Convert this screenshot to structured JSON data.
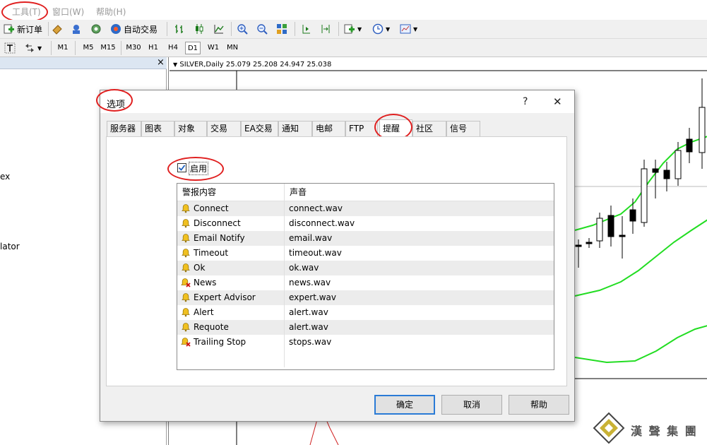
{
  "menu": {
    "tools": "工具(T)",
    "window": "窗口(W)",
    "help": "帮助(H)"
  },
  "toolbar": {
    "new_order": "新订单",
    "auto_trade": "自动交易"
  },
  "timeframes": [
    "M1",
    "M5",
    "M15",
    "M30",
    "H1",
    "H4",
    "D1",
    "W1",
    "MN"
  ],
  "active_timeframe": "D1",
  "navigator": {
    "close": "×",
    "frag1": "ex",
    "frag2": "lator"
  },
  "chart": {
    "title": "SILVER,Daily  25.079 25.208 24.947 25.038"
  },
  "dialog": {
    "title": "选项",
    "help_glyph": "?",
    "close_glyph": "✕",
    "tabs": [
      "服务器",
      "图表",
      "对象",
      "交易",
      "EA交易",
      "通知",
      "电邮",
      "FTP",
      "提醒",
      "社区",
      "信号"
    ],
    "active_tab": "提醒",
    "enable_label": "启用",
    "columns": [
      "警报内容",
      "声音"
    ],
    "rows": [
      {
        "event": "Connect",
        "sound": "connect.wav",
        "enabled": true
      },
      {
        "event": "Disconnect",
        "sound": "disconnect.wav",
        "enabled": true
      },
      {
        "event": "Email Notify",
        "sound": "email.wav",
        "enabled": true
      },
      {
        "event": "Timeout",
        "sound": "timeout.wav",
        "enabled": true
      },
      {
        "event": "Ok",
        "sound": "ok.wav",
        "enabled": true
      },
      {
        "event": "News",
        "sound": "news.wav",
        "enabled": false
      },
      {
        "event": "Expert Advisor",
        "sound": "expert.wav",
        "enabled": true
      },
      {
        "event": "Alert",
        "sound": "alert.wav",
        "enabled": true
      },
      {
        "event": "Requote",
        "sound": "alert.wav",
        "enabled": true
      },
      {
        "event": "Trailing Stop",
        "sound": "stops.wav",
        "enabled": false
      }
    ],
    "buttons": {
      "ok": "确定",
      "cancel": "取消",
      "help": "帮助"
    }
  },
  "watermark": "漢 聲 集 團",
  "colors": {
    "highlight_ring": "#e02020",
    "ma_line": "#22dd22",
    "bell": "#f0c020",
    "disabled_x": "#d01010",
    "default_button_border": "#2a7bd6"
  }
}
